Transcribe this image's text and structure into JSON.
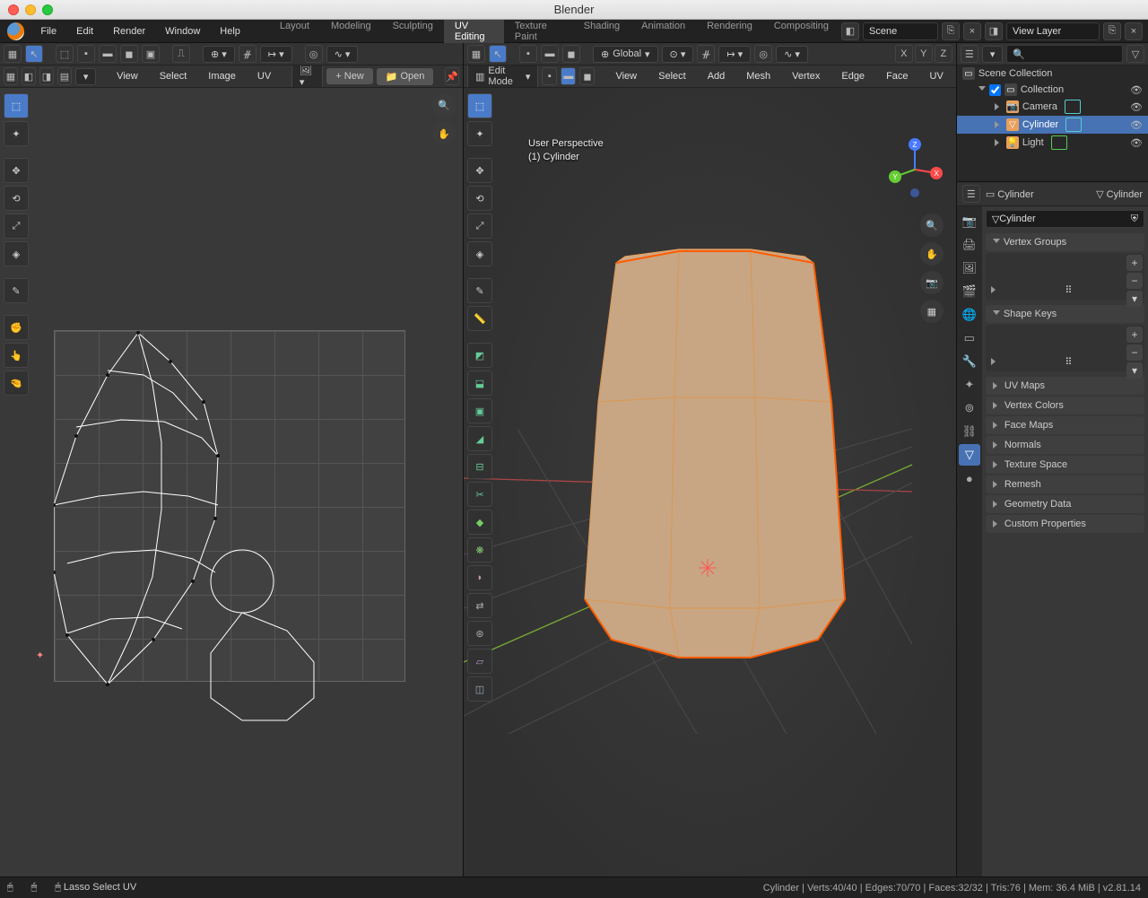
{
  "app": {
    "title": "Blender"
  },
  "menubar": [
    "File",
    "Edit",
    "Render",
    "Window",
    "Help"
  ],
  "workspaces": [
    "Layout",
    "Modeling",
    "Sculpting",
    "UV Editing",
    "Texture Paint",
    "Shading",
    "Animation",
    "Rendering",
    "Compositing"
  ],
  "active_workspace": "UV Editing",
  "scene_name": "Scene",
  "view_layer": "View Layer",
  "uv_header": {
    "menus": [
      "View",
      "Select",
      "Image",
      "UV"
    ],
    "new": "New",
    "open": "Open"
  },
  "vp_header": {
    "mode": "Edit Mode",
    "menus": [
      "View",
      "Select",
      "Add",
      "Mesh",
      "Vertex",
      "Edge",
      "Face",
      "UV"
    ],
    "orientation": "Global"
  },
  "vp_overlay": {
    "l1": "User Perspective",
    "l2": "(1) Cylinder"
  },
  "outliner": {
    "root": "Scene Collection",
    "collection": "Collection",
    "items": [
      "Camera",
      "Cylinder",
      "Light"
    ]
  },
  "props": {
    "context": "Cylinder",
    "context2": "Cylinder",
    "datablock": "Cylinder",
    "panels": {
      "vg": "Vertex Groups",
      "sk": "Shape Keys",
      "uv": "UV Maps",
      "vc": "Vertex Colors",
      "fm": "Face Maps",
      "nm": "Normals",
      "ts": "Texture Space",
      "rm": "Remesh",
      "gd": "Geometry Data",
      "cp": "Custom Properties"
    }
  },
  "status": {
    "tool": "Lasso Select UV",
    "stats": "Cylinder | Verts:40/40 | Edges:70/70 | Faces:32/32 | Tris:76 | Mem: 36.4 MiB | v2.81.14"
  }
}
